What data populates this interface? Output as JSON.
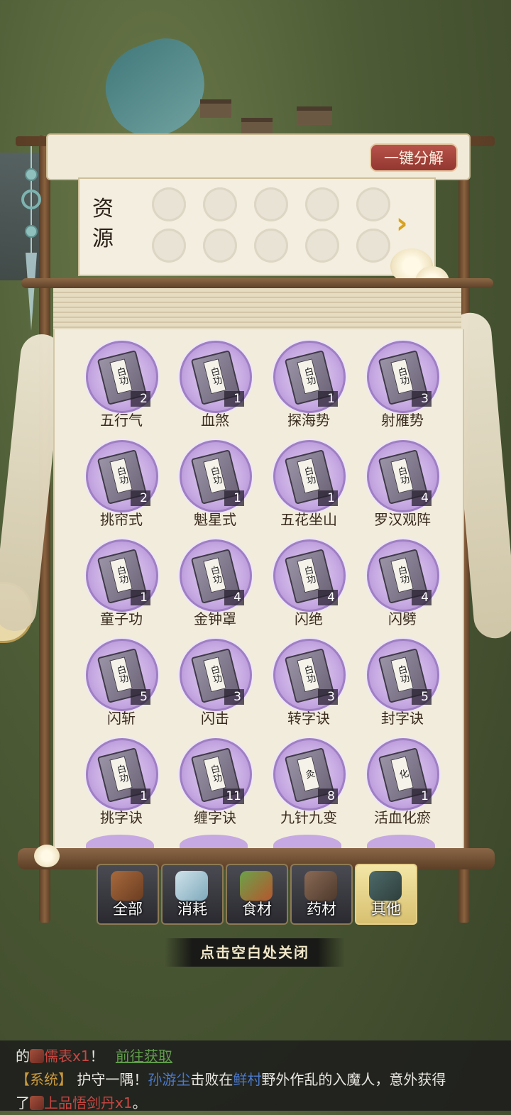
{
  "header": {
    "decompose_label": "一键分解"
  },
  "resources": {
    "label_line1": "资",
    "label_line2": "源",
    "arrow": "›"
  },
  "items": [
    {
      "name": "五行气",
      "count": "2",
      "tag": "白功"
    },
    {
      "name": "血煞",
      "count": "1",
      "tag": "白功"
    },
    {
      "name": "探海势",
      "count": "1",
      "tag": "白功"
    },
    {
      "name": "射雁势",
      "count": "3",
      "tag": "白功"
    },
    {
      "name": "挑帘式",
      "count": "2",
      "tag": "白功"
    },
    {
      "name": "魁星式",
      "count": "1",
      "tag": "白功"
    },
    {
      "name": "五花坐山",
      "count": "1",
      "tag": "白功"
    },
    {
      "name": "罗汉观阵",
      "count": "4",
      "tag": "白功"
    },
    {
      "name": "童子功",
      "count": "1",
      "tag": "白功"
    },
    {
      "name": "金钟罩",
      "count": "4",
      "tag": "白功"
    },
    {
      "name": "闪绝",
      "count": "4",
      "tag": "白功"
    },
    {
      "name": "闪劈",
      "count": "4",
      "tag": "白功"
    },
    {
      "name": "闪斩",
      "count": "5",
      "tag": "白功"
    },
    {
      "name": "闪击",
      "count": "3",
      "tag": "白功"
    },
    {
      "name": "转字诀",
      "count": "3",
      "tag": "白功"
    },
    {
      "name": "封字诀",
      "count": "5",
      "tag": "白功"
    },
    {
      "name": "挑字诀",
      "count": "1",
      "tag": "白功"
    },
    {
      "name": "缠字诀",
      "count": "11",
      "tag": "白功"
    },
    {
      "name": "九针九变",
      "count": "8",
      "tag": "灸"
    },
    {
      "name": "活血化瘀",
      "count": "1",
      "tag": "化"
    }
  ],
  "tabs": [
    {
      "label": "全部",
      "active": false
    },
    {
      "label": "消耗",
      "active": false
    },
    {
      "label": "食材",
      "active": false
    },
    {
      "label": "药材",
      "active": false
    },
    {
      "label": "其他",
      "active": true
    }
  ],
  "close_hint": "点击空白处关闭",
  "chat": {
    "line1_prefix": "的",
    "line1_item": "儒表x1",
    "line1_mid": "！",
    "line1_link": "前往获取",
    "line2_sys": "【系统】",
    "line2_text1": "护守一隅！",
    "line2_player": "孙游尘",
    "line2_text2": "击败在",
    "line2_place": "鲜村",
    "line2_text3": "野外作乱的入魔人，意外获得",
    "line3_prefix": "了",
    "line3_item": "上品悟剑丹x1",
    "line3_suffix": "。"
  },
  "colors": {
    "accent_red": "#b8534a",
    "item_purple": "#c6a9e2",
    "link_green": "#5f9b4a"
  }
}
